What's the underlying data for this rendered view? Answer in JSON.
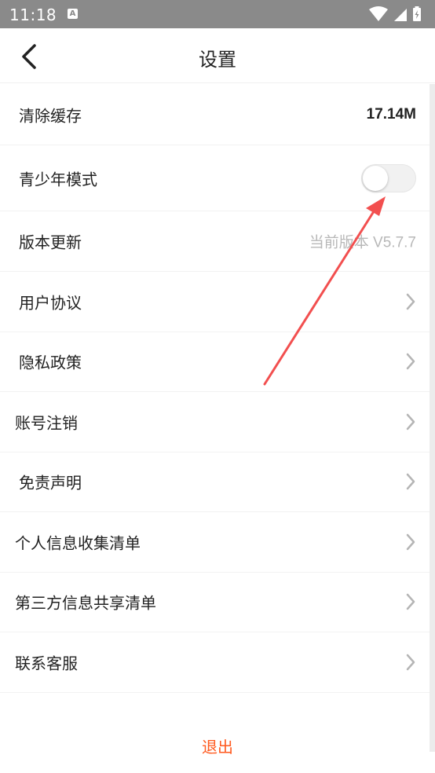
{
  "status_bar": {
    "time": "11:18",
    "notification_icon": "A"
  },
  "header": {
    "title": "设置",
    "back_icon": "chevron-left-icon"
  },
  "settings": {
    "clear_cache": {
      "label": "清除缓存",
      "value": "17.14M"
    },
    "teen_mode": {
      "label": "青少年模式",
      "enabled": false
    },
    "version_update": {
      "label": "版本更新",
      "value": "当前版本  V5.7.7"
    },
    "user_agreement": {
      "label": "用户协议"
    },
    "privacy_policy": {
      "label": "隐私政策"
    },
    "account_cancel": {
      "label": "账号注销"
    },
    "disclaimer": {
      "label": "免责声明"
    },
    "personal_info_list": {
      "label": "个人信息收集清单"
    },
    "third_party_list": {
      "label": "第三方信息共享清单"
    },
    "customer_service": {
      "label": "联系客服"
    }
  },
  "logout_label": "退出",
  "colors": {
    "accent": "#ff5a1f",
    "annotation_arrow": "#f24f4f",
    "status_bar": "#8a8a8a"
  }
}
